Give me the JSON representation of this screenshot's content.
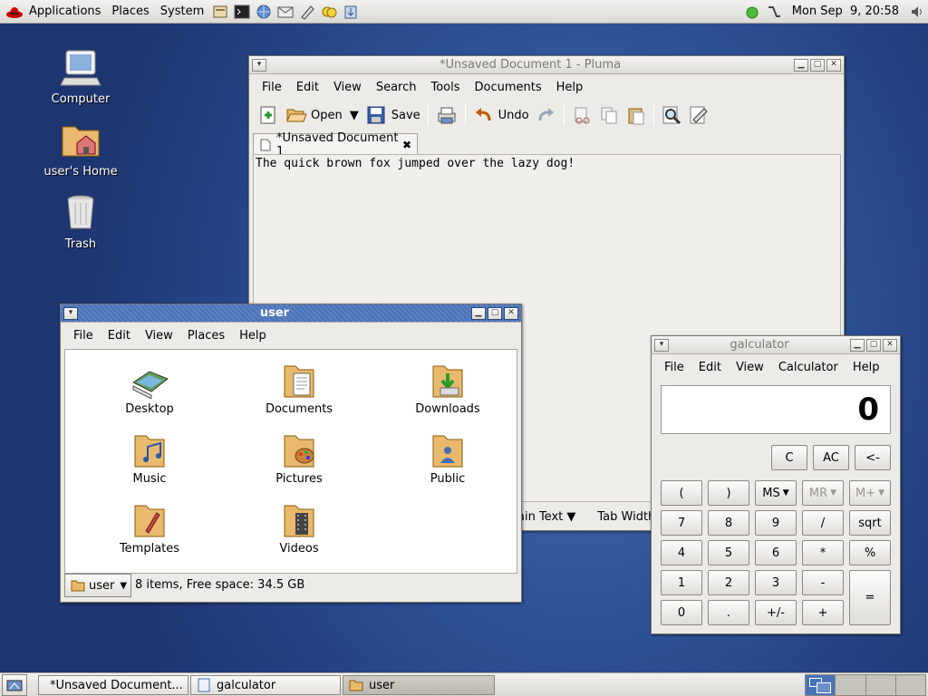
{
  "top_panel": {
    "menus": [
      "Applications",
      "Places",
      "System"
    ],
    "launchers": [
      "file-manager-icon",
      "terminal-icon",
      "network-icon",
      "mail-icon",
      "text-editor-icon",
      "messenger-icon",
      "software-update-icon"
    ],
    "clock": "Mon Sep  9, 20:58"
  },
  "desktop": {
    "icons": [
      {
        "label": "Computer",
        "icon": "computer-icon"
      },
      {
        "label": "user's Home",
        "icon": "home-folder-icon"
      },
      {
        "label": "Trash",
        "icon": "trash-icon"
      }
    ]
  },
  "pluma": {
    "title": "*Unsaved Document 1 - Pluma",
    "menus": [
      "File",
      "Edit",
      "View",
      "Search",
      "Tools",
      "Documents",
      "Help"
    ],
    "toolbar": {
      "open": "Open",
      "save": "Save",
      "undo": "Undo"
    },
    "tab": "*Unsaved Document 1",
    "text": "The quick brown fox jumped over the lazy dog!",
    "status": {
      "lang": "ain Text",
      "tab_width": "Tab Width"
    }
  },
  "filemanager": {
    "title": "user",
    "menus": [
      "File",
      "Edit",
      "View",
      "Places",
      "Help"
    ],
    "items": [
      "Desktop",
      "Documents",
      "Downloads",
      "Music",
      "Pictures",
      "Public",
      "Templates",
      "Videos"
    ],
    "location": "user",
    "status": "8 items, Free space: 34.5 GB"
  },
  "calculator": {
    "title": "galculator",
    "menus": [
      "File",
      "Edit",
      "View",
      "Calculator",
      "Help"
    ],
    "display": "0",
    "row1": [
      "C",
      "AC",
      "<-"
    ],
    "row2": [
      "(",
      ")",
      "MS",
      "MR",
      "M+"
    ],
    "row3": [
      "7",
      "8",
      "9",
      "/",
      "sqrt"
    ],
    "row4": [
      "4",
      "5",
      "6",
      "*",
      "%"
    ],
    "row5": [
      "1",
      "2",
      "3",
      "-"
    ],
    "row6": [
      "0",
      ".",
      "+/-",
      "+"
    ],
    "equals": "="
  },
  "taskbar": {
    "tasks": [
      "*Unsaved Document...",
      "galculator",
      "user"
    ]
  },
  "colors": {
    "accent": "#4a72b6",
    "desktop": "#2f5398"
  }
}
